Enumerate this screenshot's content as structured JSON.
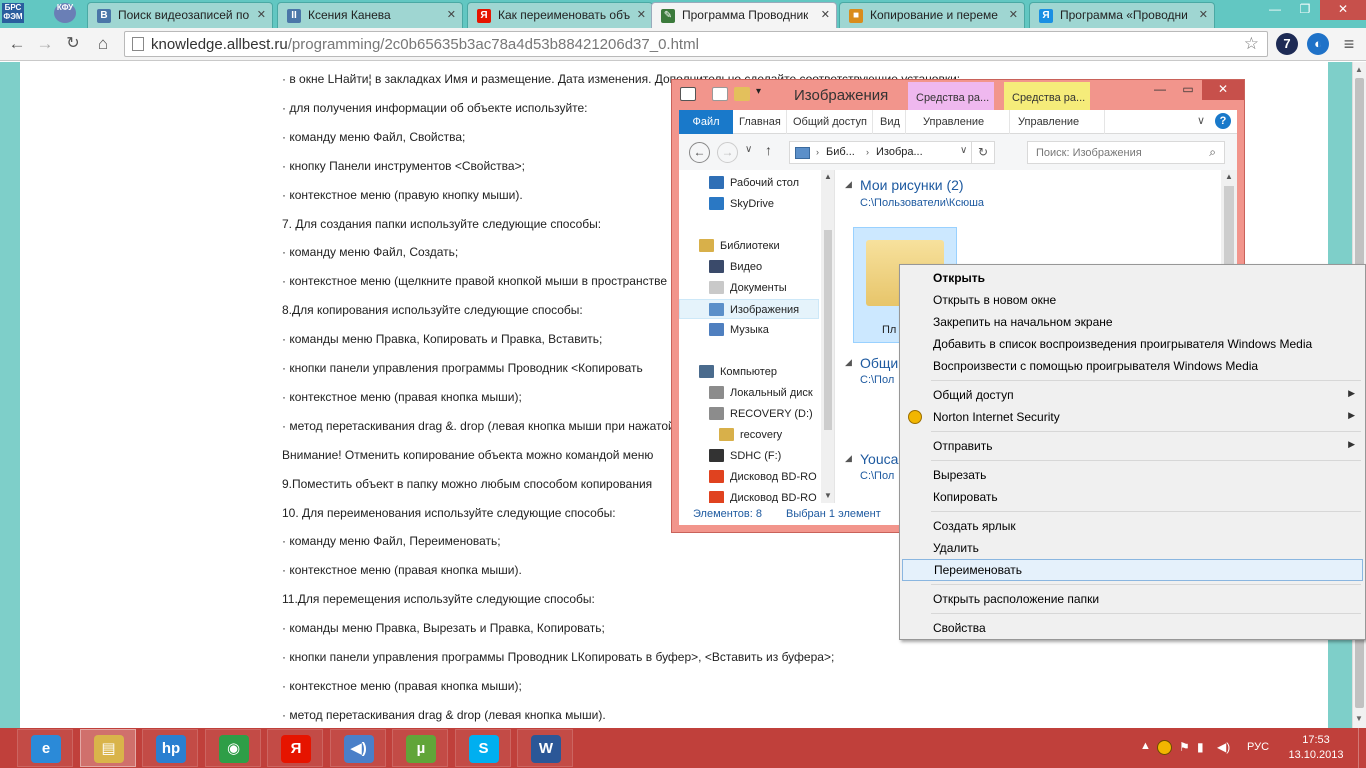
{
  "browser": {
    "app_icons": [
      {
        "label": "БРС ФЭМ",
        "icon": "brs-app-icon"
      },
      {
        "label": "КФУ",
        "icon": "kfu-app-icon"
      }
    ],
    "tabs": [
      {
        "title": "Поиск видеозаписей по",
        "favicon": "vk-favicon",
        "color": "#4a76a8",
        "glyph": "В"
      },
      {
        "title": "Ксения Канева",
        "favicon": "vk-pause-favicon",
        "color": "#4a76a8",
        "glyph": "II"
      },
      {
        "title": "Как переименовать объ",
        "favicon": "yandex-favicon",
        "color": "#e61400",
        "glyph": "Я"
      },
      {
        "title": "Программа Проводник",
        "favicon": "allbest-favicon",
        "color": "#3b7a3b",
        "glyph": "✎"
      },
      {
        "title": "Копирование и переме",
        "favicon": "docs-favicon",
        "color": "#d98c1c",
        "glyph": "■"
      },
      {
        "title": "Программа «Проводни",
        "favicon": "yandex-favicon",
        "color": "#1a8fe3",
        "glyph": "Я"
      }
    ],
    "active_tab": 3,
    "window_buttons": {
      "minimize": "—",
      "maximize": "❐",
      "close": "✕"
    },
    "url_domain": "knowledge.allbest.ru",
    "url_path": "/programming/2c0b65635b3ac78a4d53b88421206d37_0.html",
    "extension_icons": [
      {
        "label": "7",
        "color": "#1e2b55",
        "icon": "seven-extension-icon"
      },
      {
        "label": "◐",
        "color": "#1f72c8",
        "icon": "blue-extension-icon"
      }
    ]
  },
  "article": {
    "lines": [
      "· в окне LНайти¦ в закладках Имя и размещение. Дата изменения. Дополнительно сделайте соответствующие установки;",
      "· для получения информации об объекте используйте:",
      "· команду меню Файл, Свойства;",
      "· кнопку Панели инструментов <Свойства>;",
      "· контекстное меню (правую кнопку мыши).",
      "7. Для создания папки используйте следующие способы:",
      "· команду меню Файл, Создать;",
      "· контекстное меню (щелкните правой кнопкой мыши в пространстве",
      "8.Для копирования используйте следующие способы:",
      "· команды меню Правка, Копировать и Правка, Вставить;",
      "· кнопки панели управления программы Проводник <Копировать",
      "· контекстное меню (правая кнопка мыши);",
      "· метод перетаскивания drag &. drop (левая кнопка мыши при нажатой",
      "Внимание! Отменить копирование объекта можно командой меню",
      "9.Поместить объект в папку можно любым способом копирования",
      "10. Для переименования используйте следующие способы:",
      "· команду меню Файл, Переименовать;",
      "· контекстное меню (правая кнопка мыши).",
      "11.Для перемещения используйте следующие способы:",
      "· команды меню Правка, Вырезать и Правка, Копировать;",
      "· кнопки панели управления программы Проводник LКопировать в буфер>, <Вставить из буфера>;",
      "· контекстное меню (правая кнопка мыши);",
      "· метод перетаскивания drag & drop (левая кнопка мыши)."
    ]
  },
  "explorer": {
    "title": "Изображения",
    "context_tabs": [
      "Средства ра...",
      "Средства ра..."
    ],
    "context_tab_colors": [
      "#efb8ef",
      "#f5ec7a"
    ],
    "ribbon_tabs": [
      "Файл",
      "Главная",
      "Общий доступ",
      "Вид",
      "Управление",
      "Управление"
    ],
    "breadcrumb": [
      "Биб...",
      "Изобра..."
    ],
    "search_placeholder": "Поиск: Изображения",
    "nav_items": [
      {
        "label": "Рабочий стол",
        "icon": "desktop-icon",
        "color": "#2f6fb6"
      },
      {
        "label": "SkyDrive",
        "icon": "skydrive-icon",
        "color": "#2a78c4"
      },
      {
        "label": "Библиотеки",
        "icon": "libraries-icon",
        "color": "#d8b04a"
      },
      {
        "label": "Видео",
        "icon": "video-icon",
        "color": "#3a4a6a"
      },
      {
        "label": "Документы",
        "icon": "documents-icon",
        "color": "#c9c9c9"
      },
      {
        "label": "Изображения",
        "icon": "pictures-icon",
        "color": "#5b8fc9"
      },
      {
        "label": "Музыка",
        "icon": "music-icon",
        "color": "#4f7fbf"
      },
      {
        "label": "Компьютер",
        "icon": "computer-icon",
        "color": "#4a6b8d"
      },
      {
        "label": "Локальный диск",
        "icon": "local-disk-icon",
        "color": "#8c8c8c"
      },
      {
        "label": "RECOVERY (D:)",
        "icon": "recovery-disk-icon",
        "color": "#8c8c8c"
      },
      {
        "label": "recovery",
        "icon": "recovery-icon",
        "color": "#d8b04a"
      },
      {
        "label": "SDHC (F:)",
        "icon": "sdhc-icon",
        "color": "#333333"
      },
      {
        "label": "Дисковод BD-RO",
        "icon": "office-disk-icon",
        "color": "#e0421f"
      },
      {
        "label": "Дисковод BD-RO",
        "icon": "office-disk-icon",
        "color": "#e0421f"
      }
    ],
    "selected_nav": 5,
    "groups": [
      {
        "name": "Мои рисунки (2)",
        "path": "C:\\Пользователи\\Ксюша"
      },
      {
        "name": "Общи",
        "path": "C:\\Пол"
      },
      {
        "name": "Youca",
        "path": "C:\\Пол"
      }
    ],
    "folder_label": "Пл",
    "status_items": "Элементов: 8",
    "status_selected": "Выбран 1 элемент"
  },
  "context_menu": {
    "items": [
      {
        "label": "Открыть",
        "bold": true
      },
      {
        "label": "Открыть в новом окне"
      },
      {
        "label": "Закрепить на начальном экране"
      },
      {
        "label": "Добавить в список воспроизведения проигрывателя Windows Media"
      },
      {
        "label": "Воспроизвести с помощью проигрывателя Windows Media"
      },
      {
        "sep": true
      },
      {
        "label": "Общий доступ",
        "submenu": true
      },
      {
        "label": "Norton Internet Security",
        "submenu": true,
        "icon": "norton-icon"
      },
      {
        "sep": true
      },
      {
        "label": "Отправить",
        "submenu": true
      },
      {
        "sep": true
      },
      {
        "label": "Вырезать"
      },
      {
        "label": "Копировать"
      },
      {
        "sep": true
      },
      {
        "label": "Создать ярлык"
      },
      {
        "label": "Удалить"
      },
      {
        "label": "Переименовать",
        "highlighted": true
      },
      {
        "sep": true
      },
      {
        "label": "Открыть расположение папки"
      },
      {
        "sep": true
      },
      {
        "label": "Свойства"
      }
    ]
  },
  "taskbar": {
    "apps": [
      {
        "name": "internet-explorer",
        "glyph": "e",
        "color": "#2b8ad8"
      },
      {
        "name": "file-explorer",
        "glyph": "▤",
        "color": "#d9b44a"
      },
      {
        "name": "hp",
        "glyph": "hp",
        "color": "#2a7fd0"
      },
      {
        "name": "chrome",
        "glyph": "◉",
        "color": "#2e9e47"
      },
      {
        "name": "yandex",
        "glyph": "Я",
        "color": "#e61400"
      },
      {
        "name": "media-player",
        "glyph": "◀)",
        "color": "#4a7fc8"
      },
      {
        "name": "utorrent",
        "glyph": "µ",
        "color": "#61a539"
      },
      {
        "name": "skype",
        "glyph": "S",
        "color": "#00aff0"
      },
      {
        "name": "word",
        "glyph": "W",
        "color": "#2b5797"
      }
    ],
    "active_app": 1,
    "language": "РУС",
    "time": "17:53",
    "date": "13.10.2013"
  }
}
